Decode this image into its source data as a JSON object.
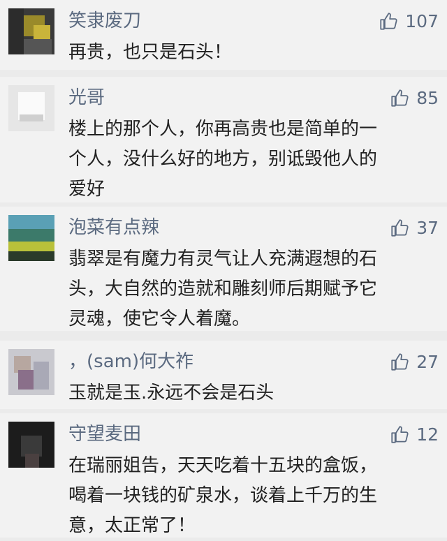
{
  "comments": [
    {
      "nickname": "笑隶废刀",
      "likes": "107",
      "lines": [
        "再贵，也只是石头！"
      ]
    },
    {
      "nickname": "光哥",
      "likes": "85",
      "lines": [
        "楼上的那个人，你再高贵也是简单的一",
        "个人，没什么好的地方，别诋毁他人的",
        "爱好"
      ]
    },
    {
      "nickname": "泡菜有点辣",
      "likes": "37",
      "lines": [
        "翡翠是有魔力有灵气让人充满遐想的石",
        "头，大自然的造就和雕刻师后期赋予它",
        "灵魂，使它令人着魔。"
      ]
    },
    {
      "nickname": "，(sam)何大祚",
      "likes": "27",
      "lines": [
        "玉就是玉.永远不会是石头"
      ]
    },
    {
      "nickname": "守望麦田",
      "likes": "12",
      "lines": [
        "在瑞丽姐告，天天吃着十五块的盒饭，",
        "喝着一块钱的矿泉水，谈着上千万的生",
        "意，太正常了！"
      ]
    }
  ],
  "icons": {
    "like": "thumbs-up-icon"
  },
  "colors": {
    "nickname": "#5b6a80",
    "text": "#222222",
    "card": "#f2f2f2",
    "divider": "#ebebeb"
  }
}
